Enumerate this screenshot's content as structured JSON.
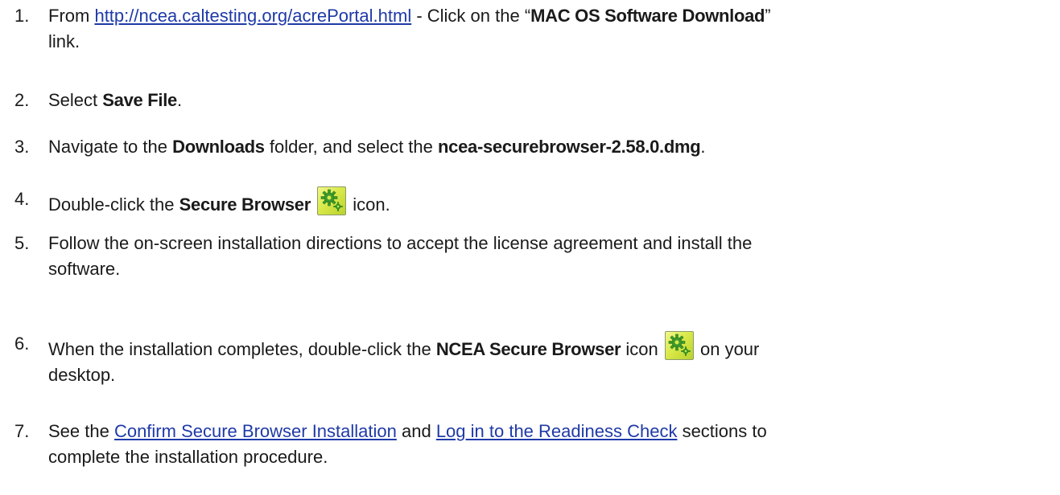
{
  "steps": [
    {
      "num": "1.",
      "t1": "From ",
      "link": "http://ncea.caltesting.org/acrePortal.html",
      "t2": " - Click on the “",
      "b1": "MAC OS Software Download",
      "t3": "”",
      "t4": "link."
    },
    {
      "num": "2.",
      "t1": "Select ",
      "b1": "Save File",
      "t2": "."
    },
    {
      "num": "3.",
      "t1": "Navigate to the ",
      "b1": "Downloads",
      "t2": " folder, and select the ",
      "b2": "ncea-securebrowser-2.58.0.dmg",
      "t3": "."
    },
    {
      "num": "4.",
      "t1": "Double-click the ",
      "b1": "Secure Browser",
      "t2": " icon.",
      "icon": "secure-browser-gear-icon"
    },
    {
      "num": "5.",
      "line1": "Follow the on-screen installation directions to accept the license agreement and install the",
      "line2": "software."
    },
    {
      "num": "6.",
      "t1": "When the installation completes, double-click the ",
      "b1": "NCEA Secure Browser",
      "t2": " icon ",
      "t3": " on your",
      "t4": "desktop.",
      "icon": "secure-browser-gear-icon"
    },
    {
      "num": "7.",
      "t1": "See the ",
      "link1": "Confirm Secure Browser Installation",
      "t2": " and ",
      "link2": "Log in to the Readiness Check",
      "t3": " sections to",
      "t4": "complete the installation procedure."
    }
  ],
  "colors": {
    "text": "#1a1a1a",
    "link": "#1f3aa8",
    "icon_green": "#c4d93a",
    "gear_green": "#3c9a2a"
  }
}
